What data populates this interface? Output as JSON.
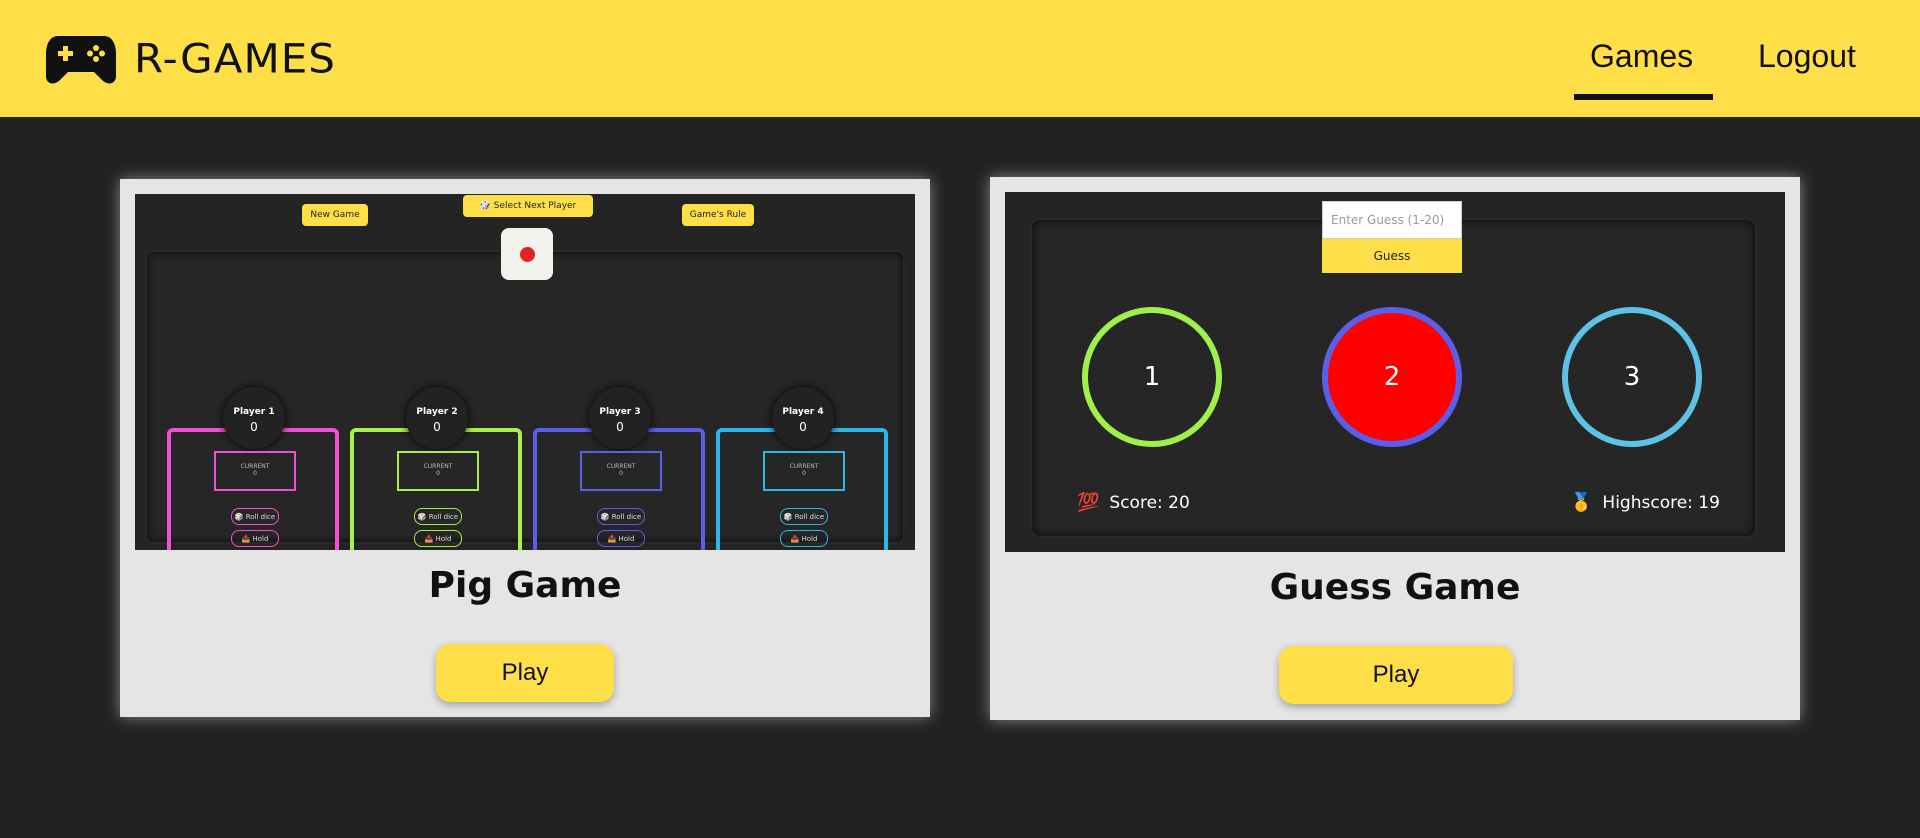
{
  "header": {
    "brand": "R-GAMES",
    "logo_icon": "gamepad-icon",
    "nav": {
      "games": "Games",
      "logout": "Logout"
    }
  },
  "cards": {
    "pig": {
      "title": "Pig Game",
      "play": "Play",
      "preview": {
        "new_game": "New Game",
        "select_next": "🎲 Select Next Player",
        "rules": "Game's Rule",
        "players": [
          {
            "name": "Player 1",
            "score": "0",
            "current_label": "CURRENT",
            "current": "0",
            "roll": "🎲 Roll dice",
            "hold": "📥 Hold",
            "color": "#f24fd6"
          },
          {
            "name": "Player 2",
            "score": "0",
            "current_label": "CURRENT",
            "current": "0",
            "roll": "🎲 Roll dice",
            "hold": "📥 Hold",
            "color": "#a6f04a"
          },
          {
            "name": "Player 3",
            "score": "0",
            "current_label": "CURRENT",
            "current": "0",
            "roll": "🎲 Roll dice",
            "hold": "📥 Hold",
            "color": "#5a5ee8"
          },
          {
            "name": "Player 4",
            "score": "0",
            "current_label": "CURRENT",
            "current": "0",
            "roll": "🎲 Roll dice",
            "hold": "📥 Hold",
            "color": "#2ab8ea"
          }
        ]
      }
    },
    "guess": {
      "title": "Guess Game",
      "play": "Play",
      "preview": {
        "input_placeholder": "Enter Guess (1-20)",
        "guess_button": "Guess",
        "circles": [
          "1",
          "2",
          "3"
        ],
        "score_emoji": "💯",
        "score": "Score: 20",
        "highscore_emoji": "🥇",
        "highscore": "Highscore: 19"
      }
    }
  },
  "colors": {
    "accent": "#ffdf48",
    "background": "#222222",
    "card": "#e5e5e5"
  }
}
